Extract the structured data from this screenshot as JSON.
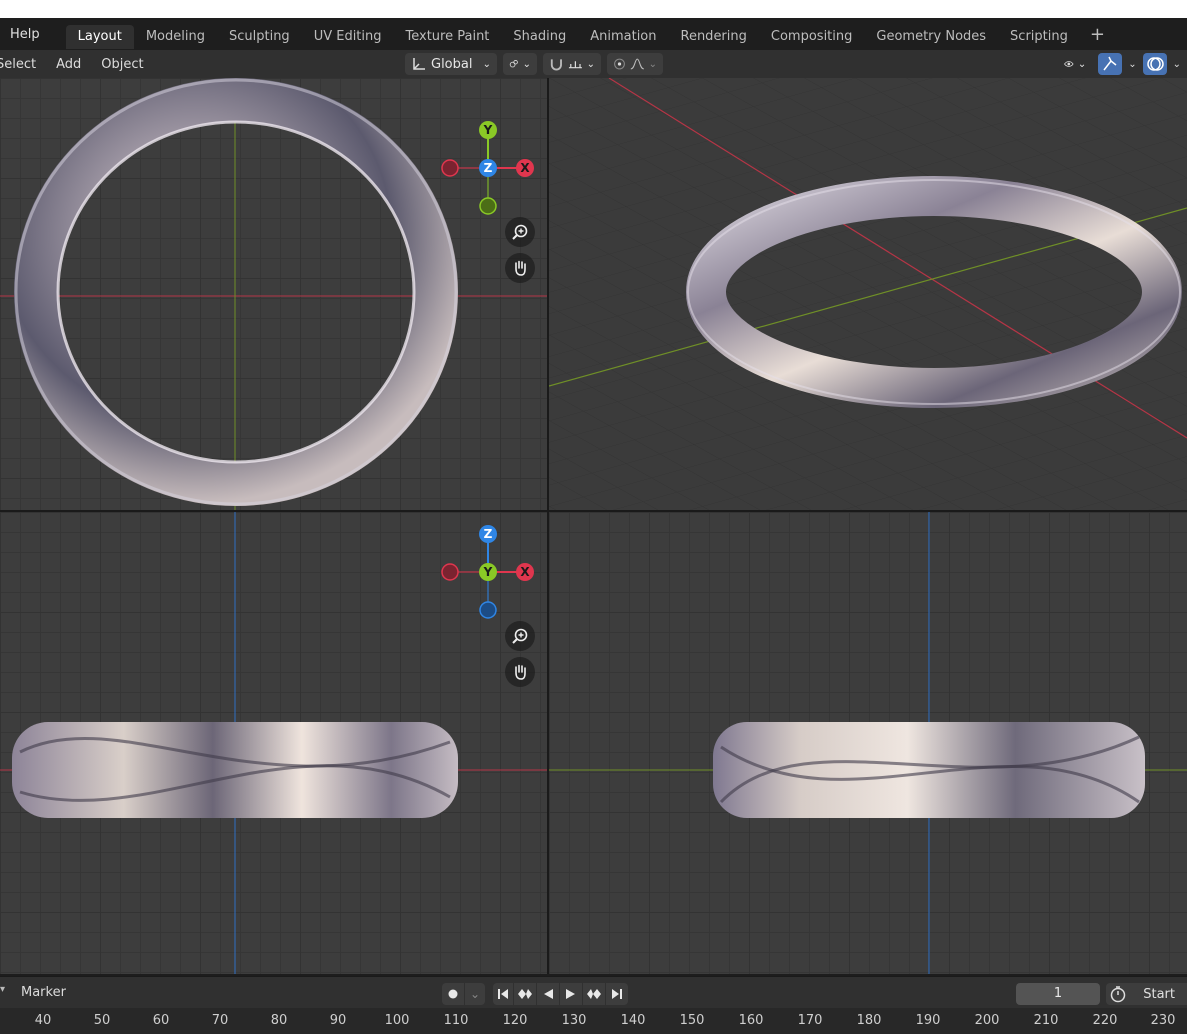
{
  "topbar": {
    "help_label": "Help",
    "tabs": [
      "Layout",
      "Modeling",
      "Sculpting",
      "UV Editing",
      "Texture Paint",
      "Shading",
      "Animation",
      "Rendering",
      "Compositing",
      "Geometry Nodes",
      "Scripting"
    ],
    "add_tab_label": "+"
  },
  "header": {
    "menus": [
      "Select",
      "Add",
      "Object"
    ],
    "orientation_label": "Global"
  },
  "gizmo_top": {
    "up": "Y",
    "center": "Z",
    "right": "X"
  },
  "gizmo_front": {
    "up": "Z",
    "center": "Y",
    "right": "X"
  },
  "timeline": {
    "marker_label": "Marker",
    "current_frame": "1",
    "start_label": "Start",
    "ruler": [
      "40",
      "50",
      "60",
      "70",
      "80",
      "90",
      "100",
      "110",
      "120",
      "130",
      "140",
      "150",
      "160",
      "170",
      "180",
      "190",
      "200",
      "210",
      "220",
      "230"
    ]
  },
  "colors": {
    "x_axis": "#e0364e",
    "y_axis": "#8ac926",
    "z_axis": "#2f86e6",
    "accent": "#4772b3"
  }
}
